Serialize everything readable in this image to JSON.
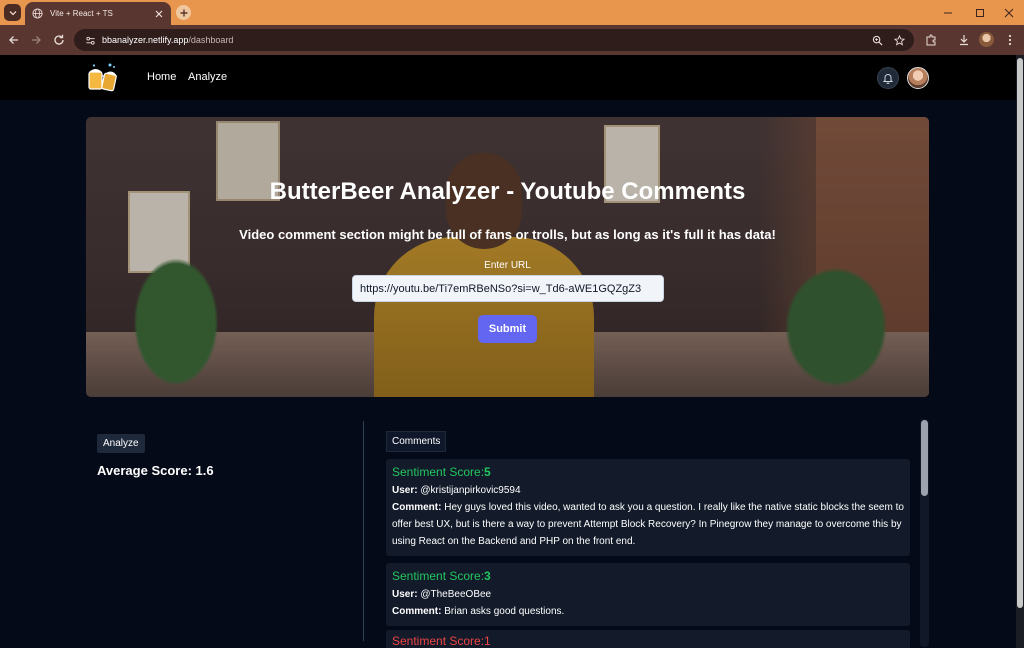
{
  "browser": {
    "tab_title": "Vite + React + TS",
    "url_host": "bbanalyzer.netlify.app",
    "url_path": "/dashboard"
  },
  "nav": {
    "links": [
      "Home",
      "Analyze"
    ]
  },
  "hero": {
    "title": "ButterBeer Analyzer - Youtube Comments",
    "subtitle": "Video comment section might be full of fans or trolls, but as long as it's full it has data!",
    "url_label": "Enter URL",
    "url_value": "https://youtu.be/Ti7emRBeNSo?si=w_Td6-aWE1GQZgZ3",
    "submit_label": "Submit"
  },
  "analyze": {
    "chip_label": "Analyze",
    "avg_score_label": "Average Score:",
    "avg_score_value": "1.6"
  },
  "comments": {
    "chip_label": "Comments",
    "sentiment_label": "Sentiment Score:",
    "user_label": "User:",
    "comment_label": "Comment:",
    "items": [
      {
        "score": "5",
        "user": "@kristijanpirkovic9594",
        "text": "Hey guys loved this video, wanted to ask you a question. I really like the native static blocks the seem to offer best UX, but is there a way to prevent Attempt Block Recovery? In Pinegrow they manage to overcome this by using React on the Backend and PHP on the front end."
      },
      {
        "score": "3",
        "user": "@TheBeeOBee",
        "text": "Brian asks good questions."
      }
    ],
    "peek_text": "Sentiment Score:1"
  },
  "colors": {
    "accent": "#6366f1",
    "positive": "#22c55e",
    "negative": "#ef4444",
    "browser_frame": "#e8954d"
  }
}
